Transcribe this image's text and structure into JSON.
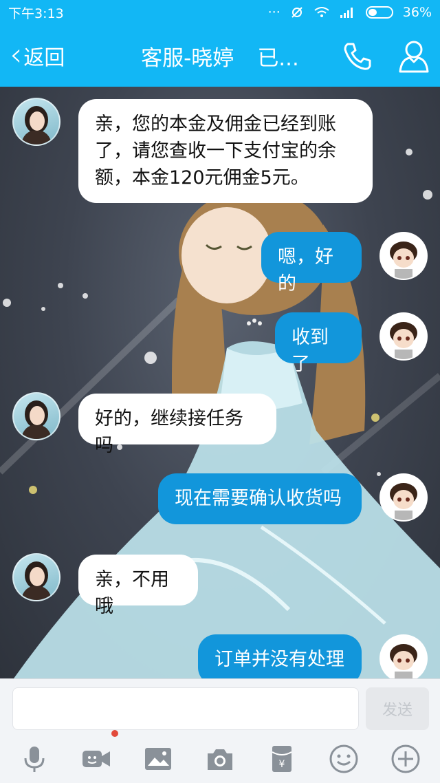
{
  "status_bar": {
    "time": "下午3:13",
    "battery": "36%"
  },
  "header": {
    "back_label": "返回",
    "title": "客服-晓婷",
    "status": "已..."
  },
  "messages": [
    {
      "side": "in",
      "text_lines": [
        "亲，您的本金及佣金已经到账",
        "了，请您查收一下支付宝的余",
        "额，本金120元佣金5元。"
      ]
    },
    {
      "side": "out",
      "text": "嗯，好的"
    },
    {
      "side": "out",
      "text": "收到了"
    },
    {
      "side": "in",
      "text": "好的，继续接任务吗"
    },
    {
      "side": "out",
      "text": "现在需要确认收货吗"
    },
    {
      "side": "in",
      "text": "亲，不用哦"
    },
    {
      "side": "out",
      "text": "订单并没有处理"
    }
  ],
  "input": {
    "placeholder": "",
    "send_label": "发送"
  },
  "toolbar": {
    "icons": [
      "microphone-icon",
      "video-call-icon",
      "image-icon",
      "camera-icon",
      "red-packet-icon",
      "emoji-icon",
      "plus-icon"
    ]
  },
  "colors": {
    "header": "#12b7f5",
    "outgoing_bubble": "#1296db",
    "incoming_bubble": "#ffffff"
  }
}
